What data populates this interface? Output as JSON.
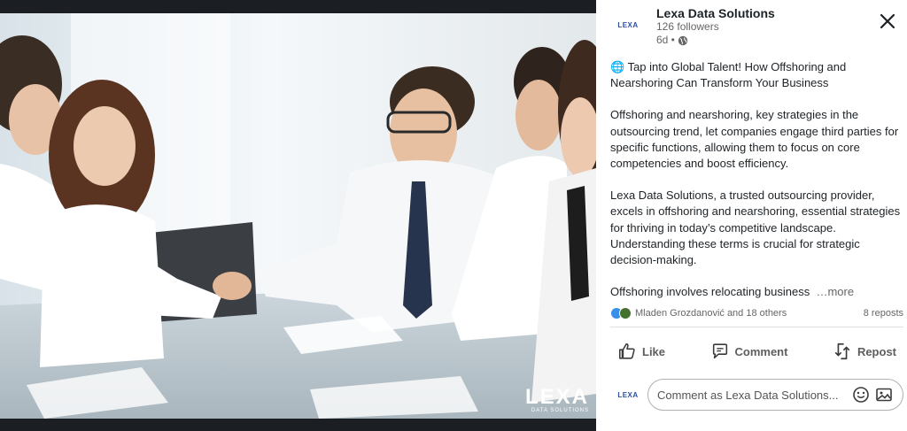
{
  "author": {
    "logo_text": "LEXA",
    "name": "Lexa Data Solutions",
    "followers": "126 followers",
    "time": "6d •"
  },
  "post": {
    "headline": "🌐 Tap into Global Talent! How Offshoring and Nearshoring Can Transform Your Business",
    "p1": "Offshoring and nearshoring, key strategies in the outsourcing trend, let companies engage third parties for specific functions, allowing them to focus on core competencies and boost efficiency.",
    "p2": "Lexa Data Solutions, a trusted outsourcing provider, excels in offshoring and nearshoring, essential strategies for thriving in today’s competitive landscape. Understanding these terms is crucial for strategic decision-making.",
    "p3": "Offshoring involves relocating business",
    "more": "…more"
  },
  "social": {
    "reactions": "Mladen Grozdanović and 18 others",
    "reposts": "8 reposts"
  },
  "actions": {
    "like": "Like",
    "comment": "Comment",
    "repost": "Repost"
  },
  "comment": {
    "placeholder": "Comment as Lexa Data Solutions..."
  },
  "media": {
    "watermark": "LEXA",
    "watermark_sub": "DATA SOLUTIONS"
  },
  "colors": {
    "accent": "#0a66c2",
    "text": "#1d2226",
    "muted": "#666666"
  }
}
